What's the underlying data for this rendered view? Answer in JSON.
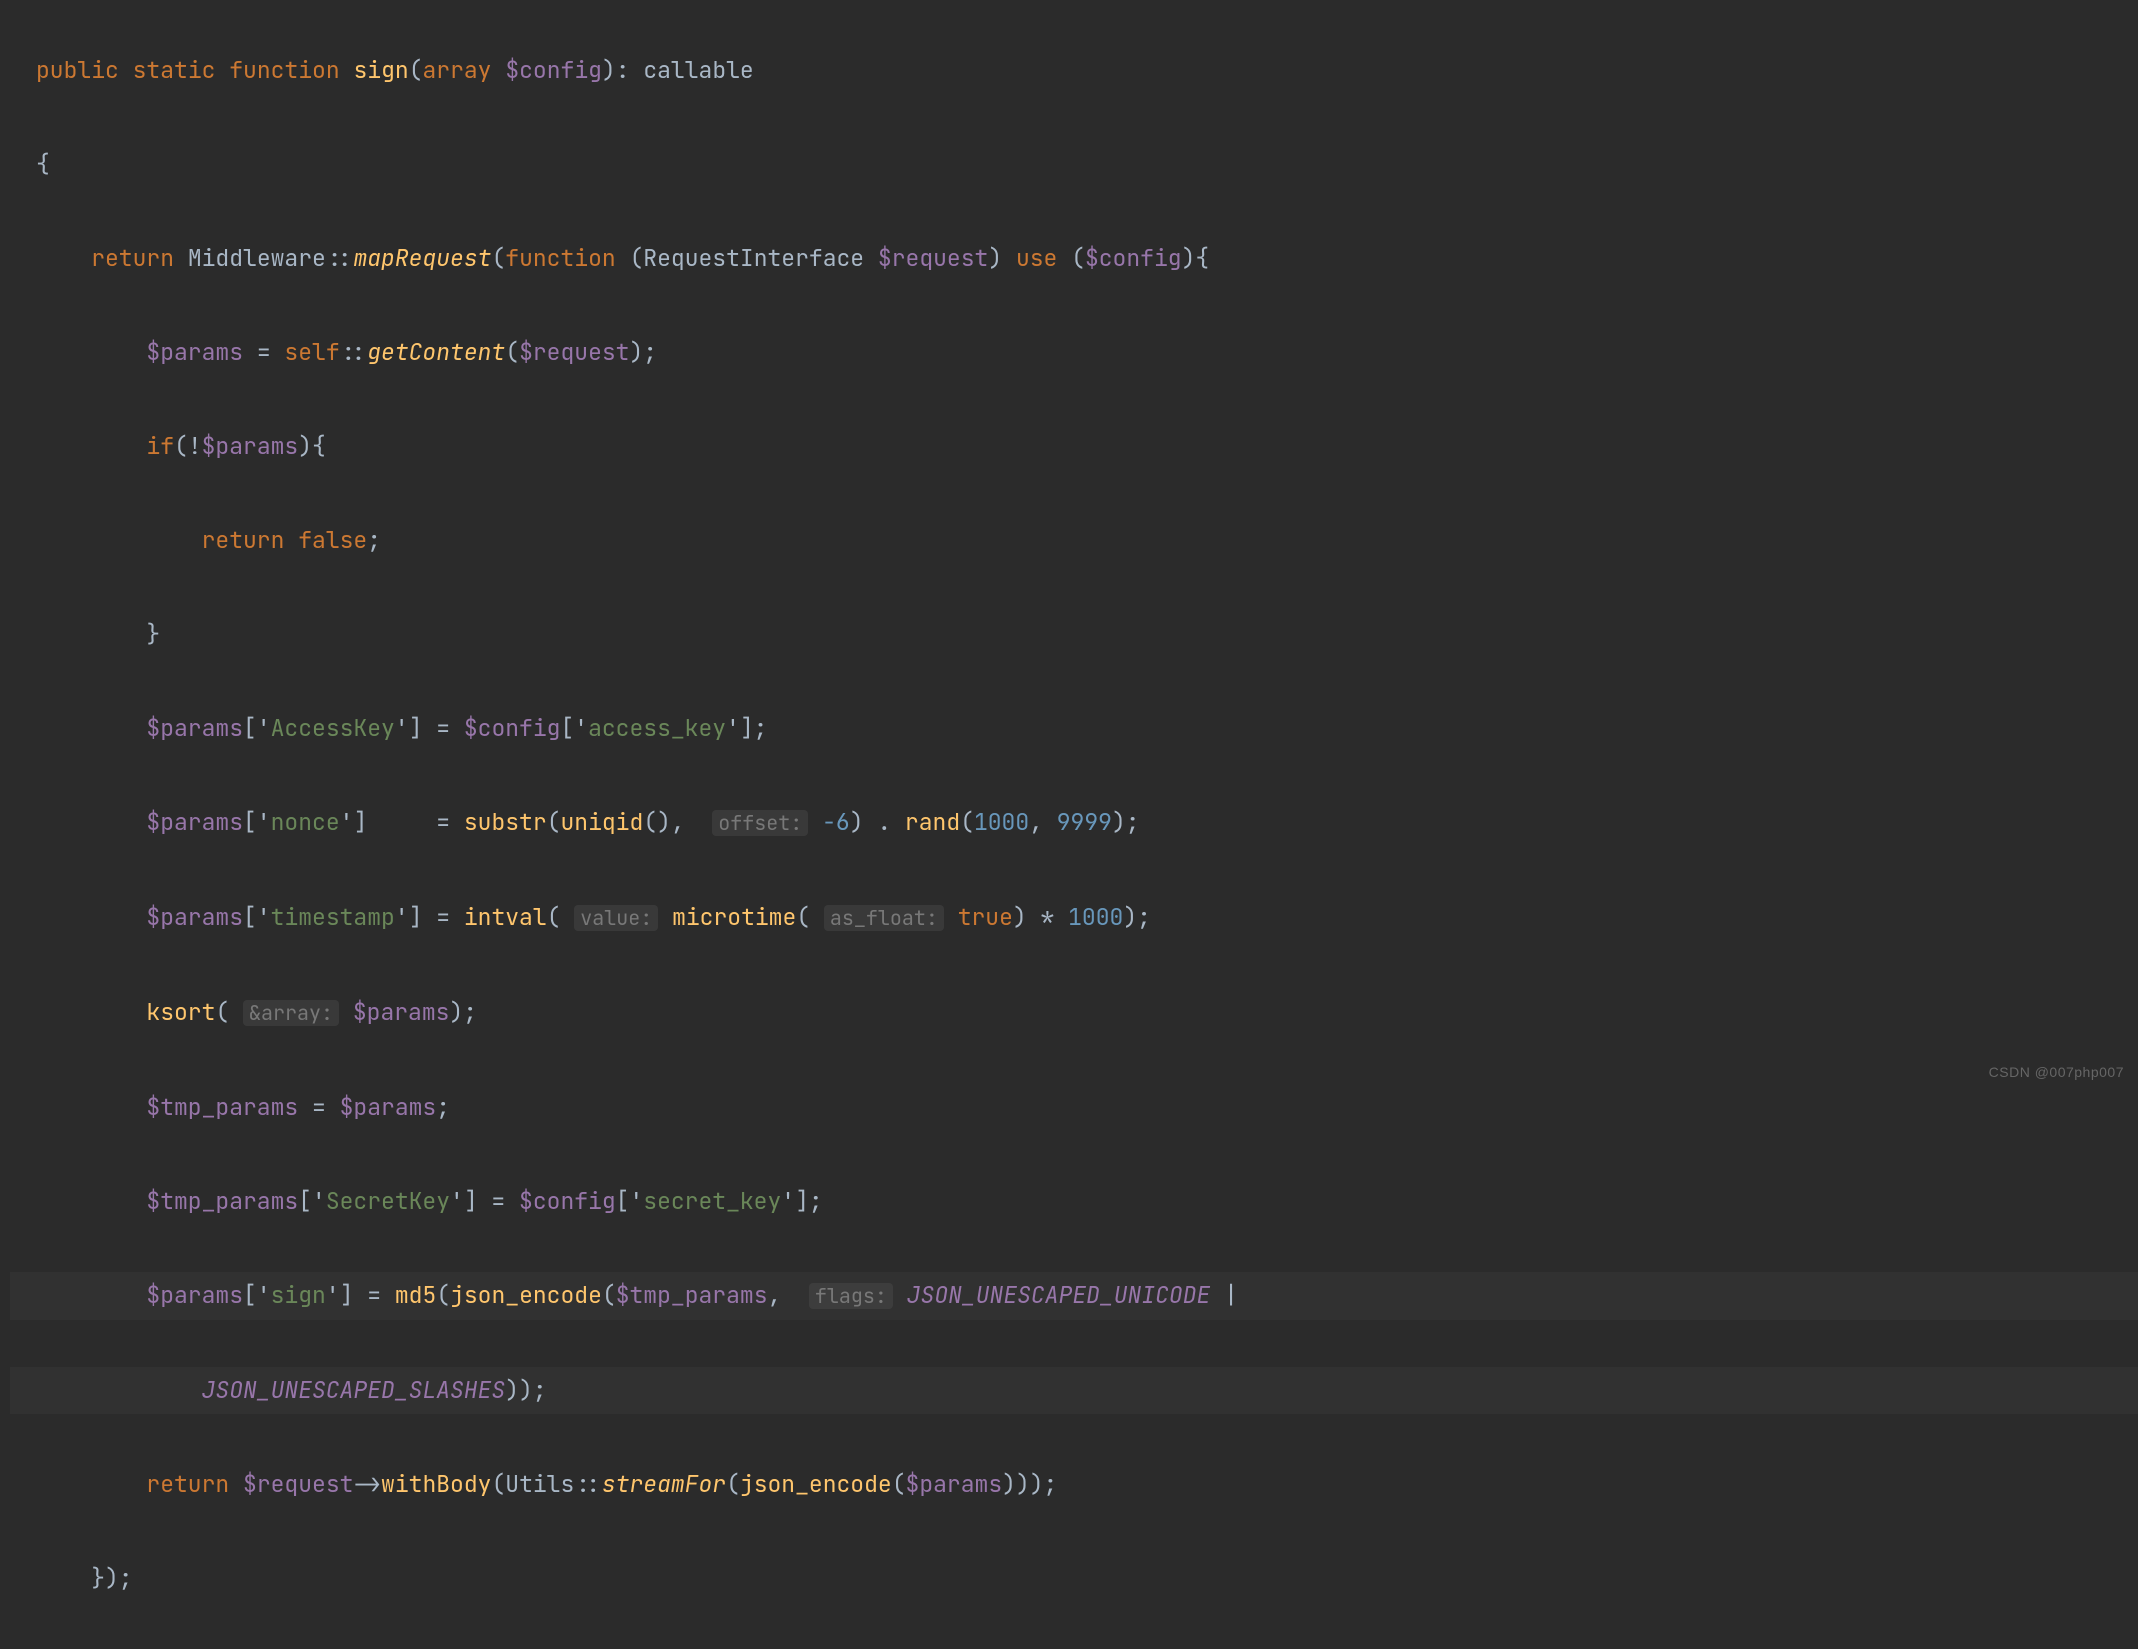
{
  "watermark": "CSDN @007php007",
  "code": {
    "l1": {
      "kw1": "public",
      "kw2": "static",
      "kw3": "function",
      "fn": "sign",
      "pn1": "(",
      "kw4": "array",
      "var": "$config",
      "pn2": "): ",
      "ty": "callable"
    },
    "l2": {
      "brace": "{"
    },
    "l3": {
      "kw": "return",
      "cls": "Middleware",
      "op": "::",
      "fn": "mapRequest",
      "pn1": "(",
      "kw2": "function",
      "pn2": " (",
      "ty": "RequestInterface",
      "var": "$request",
      "pn3": ") ",
      "kw3": "use",
      "pn4": " (",
      "var2": "$config",
      "pn5": "){"
    },
    "l4": {
      "var": "$params",
      "eq": " = ",
      "kw": "self",
      "op": "::",
      "fn": "getContent",
      "pn1": "(",
      "var2": "$request",
      "pn2": ");"
    },
    "l5": {
      "kw": "if",
      "pn1": "(!",
      "var": "$params",
      "pn2": "){"
    },
    "l6": {
      "kw": "return",
      "val": "false",
      "pn": ";"
    },
    "l7": {
      "brace": "}"
    },
    "l8": {
      "var": "$params",
      "idx": "['",
      "str": "AccessKey",
      "idx2": "'] = ",
      "var2": "$config",
      "idx3": "['",
      "str2": "access_key",
      "idx4": "'];"
    },
    "l9": {
      "var": "$params",
      "idx": "['",
      "str": "nonce",
      "idx2": "']     = ",
      "fn": "substr",
      "pn1": "(",
      "fn2": "uniqid",
      "pn2": "(),  ",
      "hint": "offset:",
      "num": "-6",
      "pn3": ") . ",
      "fn3": "rand",
      "pn4": "(",
      "num2": "1000",
      "pn5": ", ",
      "num3": "9999",
      "pn6": ");"
    },
    "l10": {
      "var": "$params",
      "idx": "['",
      "str": "timestamp",
      "idx2": "'] = ",
      "fn": "intval",
      "pn1": "( ",
      "hint": "value:",
      "fn2": "microtime",
      "pn2": "( ",
      "hint2": "as_float:",
      "kw": "true",
      "pn3": ") * ",
      "num": "1000",
      "pn4": ");"
    },
    "l11": {
      "fn": "ksort",
      "pn1": "( ",
      "hint": "&array:",
      "var": "$params",
      "pn2": ");"
    },
    "l12": {
      "var": "$tmp_params",
      "eq": " = ",
      "var2": "$params",
      "pn": ";"
    },
    "l13": {
      "var": "$tmp_params",
      "idx": "['",
      "str": "SecretKey",
      "idx2": "'] = ",
      "var2": "$config",
      "idx3": "['",
      "str2": "secret_key",
      "idx4": "'];"
    },
    "l14": {
      "var": "$params",
      "idx": "['",
      "str": "sign",
      "idx2": "'] = ",
      "fn": "md5",
      "pn1": "(",
      "fn2": "json_encode",
      "pn2": "(",
      "var2": "$tmp_params",
      "pn3": ",  ",
      "hint": "flags:",
      "const": "JSON_UNESCAPED_UNICODE",
      "pn4": " |"
    },
    "l15": {
      "const": "JSON_UNESCAPED_SLASHES",
      "pn": "));"
    },
    "l16": {
      "kw": "return",
      "var": "$request",
      "arrow": "->",
      "fn": "withBody",
      "pn1": "(",
      "cls": "Utils",
      "op": "::",
      "fn2": "streamFor",
      "pn2": "(",
      "fn3": "json_encode",
      "pn3": "(",
      "var2": "$params",
      "pn4": ")));"
    },
    "l17": {
      "brace": "});"
    }
  }
}
